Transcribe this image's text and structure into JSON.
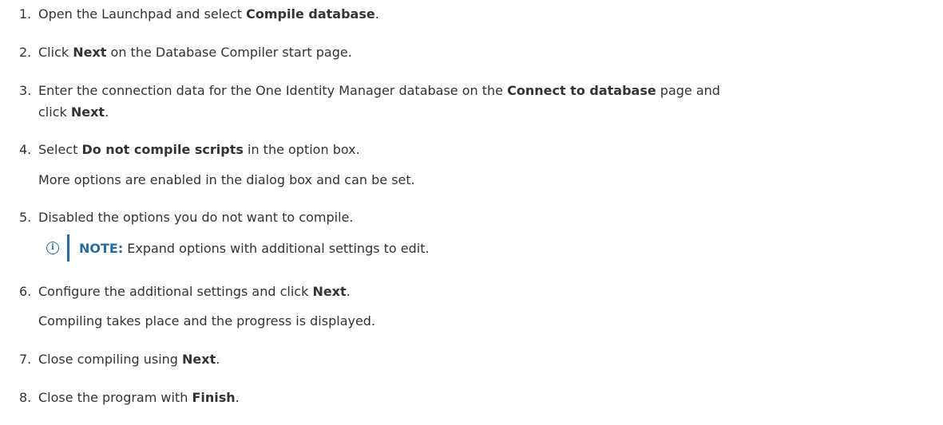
{
  "steps": [
    {
      "num": "1.",
      "pre": "Open the Launchpad and select ",
      "bold": "Compile database",
      "post": "."
    },
    {
      "num": "2.",
      "pre": "Click ",
      "bold": "Next",
      "post": " on the Database Compiler start page."
    },
    {
      "num": "3.",
      "pre": "Enter the connection data for the One Identity Manager database on the ",
      "bold": "Connect to database",
      "post": " page and",
      "cont_pre": "click ",
      "cont_bold": "Next",
      "cont_post": "."
    },
    {
      "num": "4.",
      "pre": "Select ",
      "bold": "Do not compile scripts",
      "post": " in the option box.",
      "sub": "More options are enabled in the dialog box and can be set."
    },
    {
      "num": "5.",
      "text": "Disabled the options you do not want to compile."
    },
    {
      "num": "6.",
      "pre": "Configure the additional settings and click ",
      "bold": "Next",
      "post": ".",
      "sub": "Compiling takes place and the progress is displayed."
    },
    {
      "num": "7.",
      "pre": "Close compiling using ",
      "bold": "Next",
      "post": "."
    },
    {
      "num": "8.",
      "pre": "Close the program with ",
      "bold": "Finish",
      "post": "."
    }
  ],
  "note": {
    "icon": "info-icon",
    "label": "NOTE:",
    "text": "Expand options with additional settings to edit."
  },
  "colors": {
    "text": "#333333",
    "accent": "#2a6ca0"
  }
}
